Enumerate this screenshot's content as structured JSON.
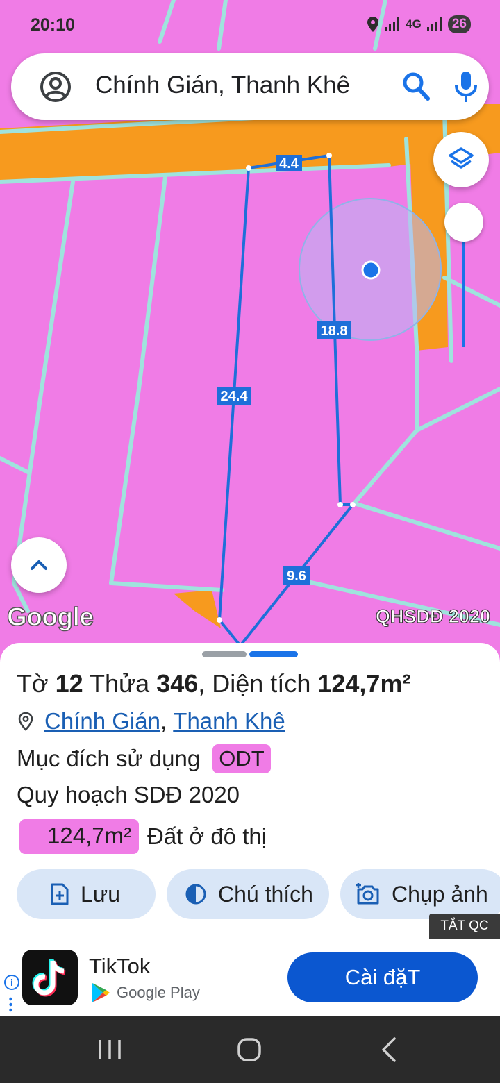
{
  "status_bar": {
    "time": "20:10",
    "network": "4G",
    "battery": "26"
  },
  "search": {
    "query": "Chính Gián, Thanh Khê"
  },
  "map": {
    "edge_labels": [
      "4.4",
      "18.8",
      "24.4",
      "9.6"
    ],
    "attribution": "Google",
    "layer_name": "QHSDĐ 2020",
    "colors": {
      "residential": "#f07ce6",
      "road": "#f79a1e",
      "boundary": "#9fe3dd",
      "parcel_outline": "#1e6fd9",
      "location": "#1a73e8"
    }
  },
  "sheet": {
    "parcel": {
      "sheet_label": "Tờ",
      "sheet_no": "12",
      "lot_label": "Thửa",
      "lot_no": "346",
      "area_label": ", Diện tích",
      "area": "124,7m²"
    },
    "location": {
      "ward": "Chính Gián",
      "separator": ",",
      "district": "Thanh Khê"
    },
    "purpose": {
      "label": "Mục đích sử dụng",
      "code": "ODT"
    },
    "plan_label": "Quy hoạch SDĐ 2020",
    "land_use": {
      "area": "124,7m²",
      "type": "Đất ở đô thị"
    },
    "actions": {
      "save": "Lưu",
      "legend": "Chú thích",
      "screenshot": "Chụp ảnh"
    }
  },
  "ad": {
    "close_label": "TẮT QC",
    "app_name": "TikTok",
    "store": "Google Play",
    "install": "Cài đặT",
    "info": "i"
  }
}
